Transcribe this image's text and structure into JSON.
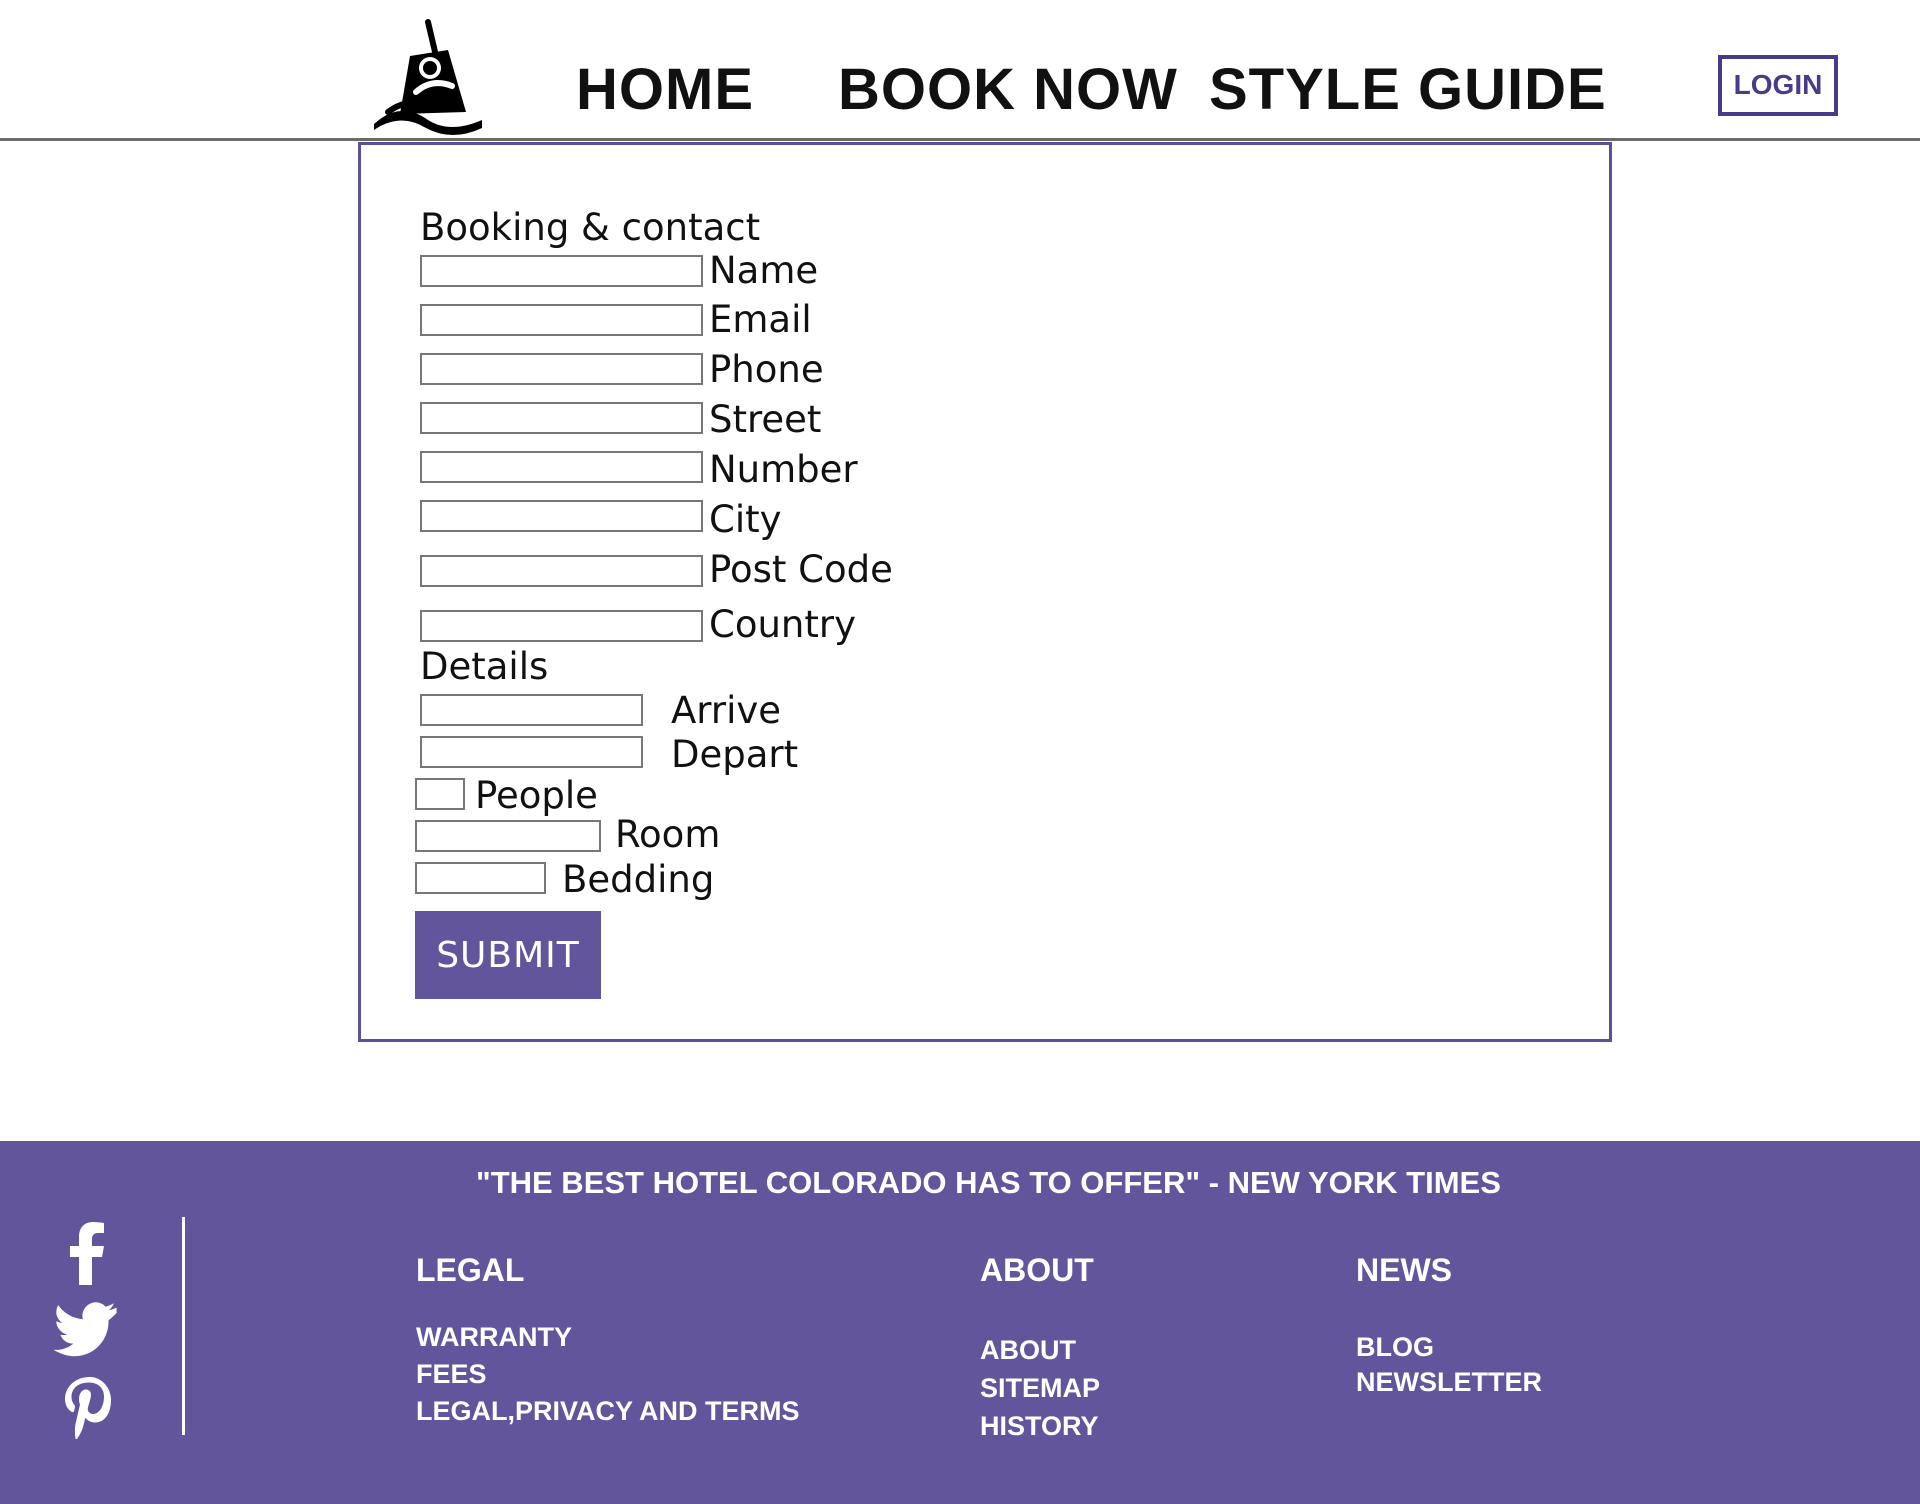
{
  "header": {
    "nav": {
      "home": "HOME",
      "book_now": "BOOK NOW",
      "style_guide": "STYLE GUIDE"
    },
    "login_label": "LOGIN"
  },
  "form": {
    "section_contact_title": "Booking & contact",
    "contact_fields": [
      {
        "label": "Name",
        "value": ""
      },
      {
        "label": "Email",
        "value": ""
      },
      {
        "label": "Phone",
        "value": ""
      },
      {
        "label": "Street",
        "value": ""
      },
      {
        "label": "Number",
        "value": ""
      },
      {
        "label": "City",
        "value": ""
      },
      {
        "label": "Post Code",
        "value": ""
      },
      {
        "label": "Country",
        "value": ""
      }
    ],
    "section_details_title": "Details",
    "detail_fields": [
      {
        "label": "Arrive",
        "value": ""
      },
      {
        "label": "Depart",
        "value": ""
      },
      {
        "label": "People",
        "value": ""
      },
      {
        "label": "Room",
        "value": ""
      },
      {
        "label": "Bedding",
        "value": ""
      }
    ],
    "submit_label": "SUBMIT"
  },
  "footer": {
    "quote": "\"THE BEST HOTEL COLORADO HAS TO OFFER\" - NEW YORK TIMES",
    "social_icons": [
      "facebook-icon",
      "twitter-icon",
      "pinterest-icon"
    ],
    "columns": [
      {
        "heading": "LEGAL",
        "links": [
          "WARRANTY",
          "FEES",
          "LEGAL,PRIVACY AND TERMS"
        ]
      },
      {
        "heading": "ABOUT",
        "links": [
          "ABOUT",
          "SITEMAP",
          "HISTORY"
        ]
      },
      {
        "heading": "NEWS",
        "links": [
          "BLOG",
          "NEWSLETTER"
        ]
      }
    ]
  },
  "colors": {
    "accent": "#62559c",
    "login_border": "#4a3a8c",
    "header_rule": "#6b6b6b"
  }
}
